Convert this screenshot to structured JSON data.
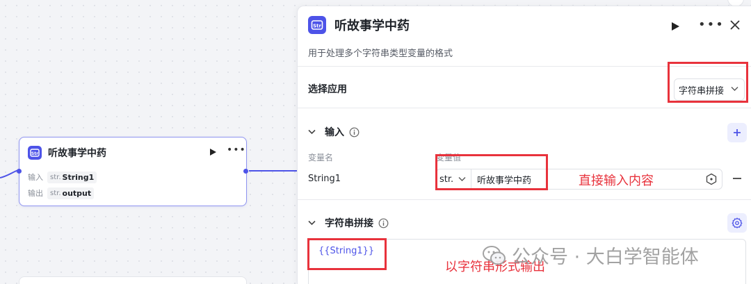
{
  "canvas": {
    "node": {
      "title": "听故事学中药",
      "input_label": "输入",
      "input_type": "str.",
      "input_name": "String1",
      "output_label": "输出",
      "output_type": "str.",
      "output_name": "output"
    }
  },
  "panel": {
    "title": "听故事学中药",
    "description": "用于处理多个字符串类型变量的格式",
    "select_label": "选择应用",
    "select_value": "字符串拼接",
    "input_section": {
      "title": "输入",
      "col_name": "变量名",
      "col_value": "变量值",
      "row": {
        "name": "String1",
        "type": "str.",
        "value": "听故事学中药"
      }
    },
    "concat_section": {
      "title": "字符串拼接",
      "template": "{{String1}}"
    }
  },
  "annotations": {
    "direct_input": "直接输入内容",
    "string_output": "以字符串形式输出"
  },
  "watermark": "公众号 · 大白学智能体",
  "colors": {
    "accent": "#4d53e8",
    "annotation_red": "#e8323c"
  },
  "icons": [
    "play-icon",
    "more-icon",
    "close-icon",
    "chevron-down-icon",
    "info-icon",
    "plus-icon",
    "gear-icon",
    "expression-icon",
    "minus-icon",
    "wechat-icon"
  ]
}
